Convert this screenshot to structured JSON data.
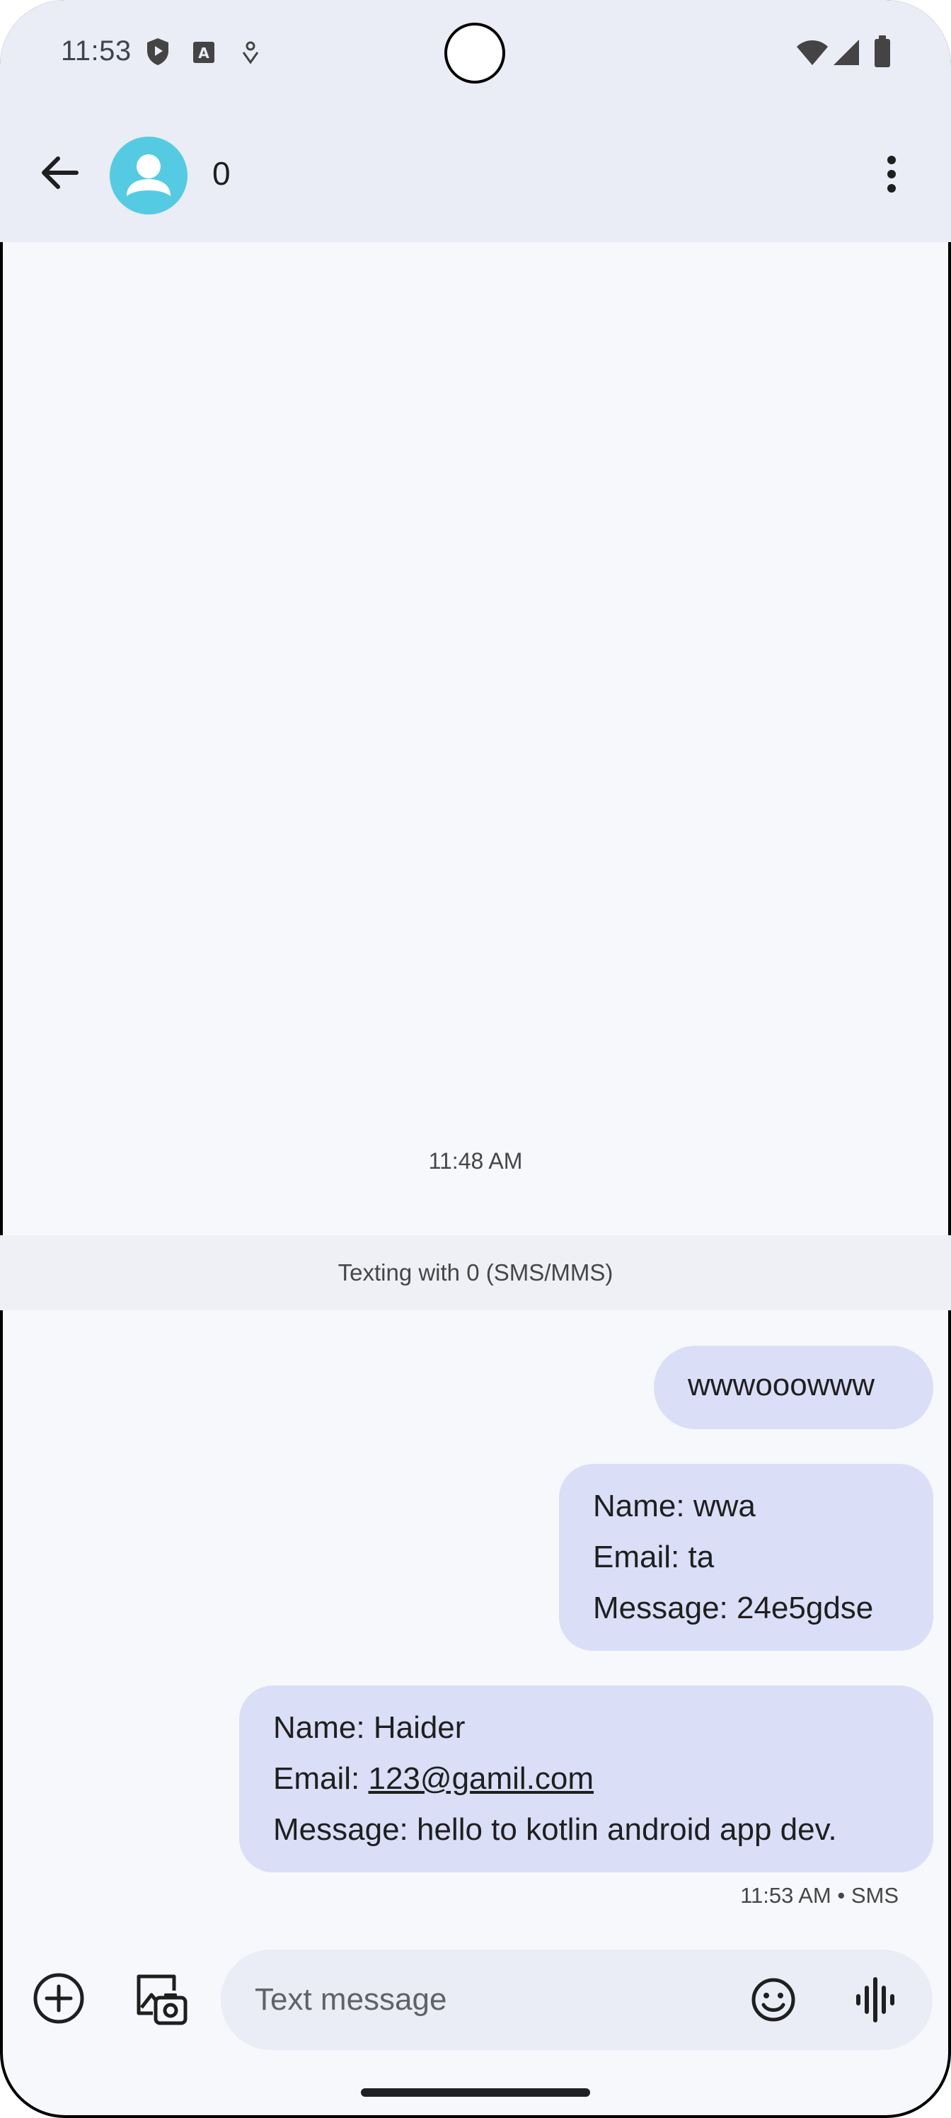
{
  "status_bar": {
    "time": "11:53",
    "icons": [
      "play-protect-icon",
      "a-text-icon",
      "location-pin-icon",
      "wifi-icon",
      "signal-icon",
      "battery-icon"
    ]
  },
  "header": {
    "back_icon": "arrow-back-icon",
    "avatar_icon": "person-icon",
    "contact_name": "0",
    "menu_icon": "more-vert-icon"
  },
  "conversation": {
    "date_header": "11:48 AM",
    "info_text": "Texting with 0 (SMS/MMS)",
    "messages": [
      {
        "lines": [
          "wwwooowww"
        ]
      },
      {
        "lines": [
          "Name: wwa",
          "Email: ta",
          "Message: 24e5gdse"
        ]
      },
      {
        "line1": "Name: Haider",
        "line2_prefix": "Email: ",
        "line2_link": "123@gamil.com",
        "line3": "Message: hello to kotlin android app dev."
      }
    ],
    "last_message_meta": "11:53 AM • SMS"
  },
  "composer": {
    "placeholder": "Text message",
    "icons": [
      "add-circle-icon",
      "gallery-camera-icon",
      "emoji-icon",
      "voice-waveform-icon"
    ]
  },
  "colors": {
    "background": "#f6f8fc",
    "header_bg": "#eaedf5",
    "bubble_bg": "#dadff7",
    "avatar": "#55cbe3"
  }
}
